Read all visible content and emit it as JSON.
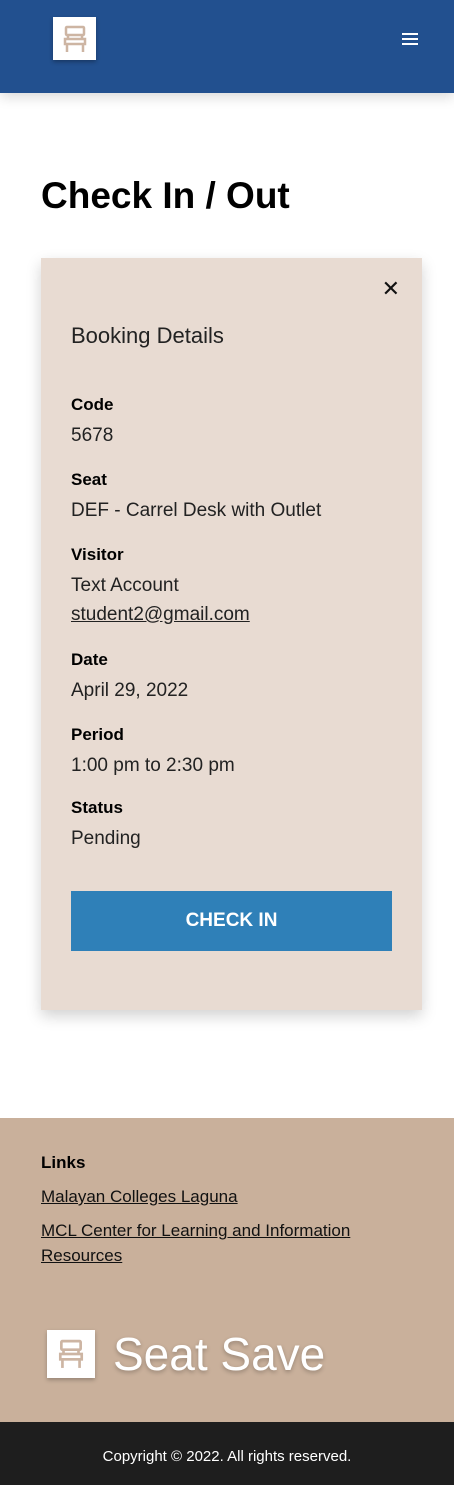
{
  "header": {
    "logo_icon": "chair-icon",
    "menu_icon": "hamburger-icon"
  },
  "page_title": "Check In / Out",
  "card": {
    "title": "Booking Details",
    "fields": [
      {
        "label": "Code",
        "value": "5678"
      },
      {
        "label": "Seat",
        "value": "DEF - Carrel Desk with Outlet"
      },
      {
        "label": "Visitor",
        "value": "Text Account",
        "email": "student2@gmail.com"
      },
      {
        "label": "Date",
        "value": "April 29, 2022"
      },
      {
        "label": "Period",
        "value": "1:00 pm to 2:30 pm"
      },
      {
        "label": "Status",
        "value": "Pending"
      }
    ],
    "button": "CHECK IN"
  },
  "footer": {
    "links_title": "Links",
    "links": [
      "Malayan Colleges Laguna",
      "MCL Center for Learning and Information Resources"
    ],
    "brand": "Seat Save"
  },
  "copyright": "Copyright © 2022. All rights reserved.",
  "colors": {
    "header": "#22508f",
    "card": "#e8dbd2",
    "button": "#2f80b8",
    "footer": "#c9b09b",
    "bottom": "#1e1e1e"
  }
}
